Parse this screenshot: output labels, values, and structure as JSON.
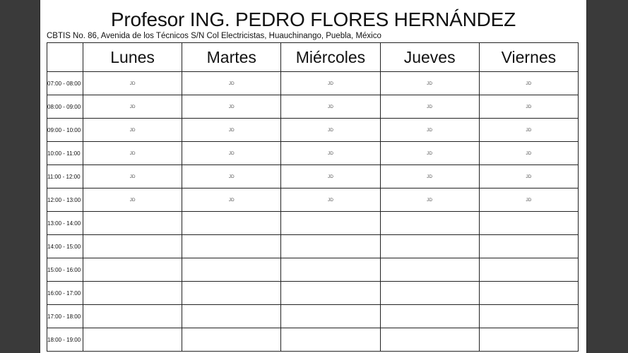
{
  "title": "Profesor ING. PEDRO FLORES HERNÁNDEZ",
  "address": "CBTIS No. 86, Avenida de los Técnicos S/N Col Electricistas, Huauchinango, Puebla, México",
  "days": [
    "Lunes",
    "Martes",
    "Miércoles",
    "Jueves",
    "Viernes"
  ],
  "rows": [
    {
      "time": "07:00 - 08:00",
      "cells": [
        "JD",
        "JD",
        "JD",
        "JD",
        "JD"
      ]
    },
    {
      "time": "08:00 - 09:00",
      "cells": [
        "JD",
        "JD",
        "JD",
        "JD",
        "JD"
      ]
    },
    {
      "time": "09:00 - 10:00",
      "cells": [
        "JD",
        "JD",
        "JD",
        "JD",
        "JD"
      ]
    },
    {
      "time": "10:00 - 11:00",
      "cells": [
        "JD",
        "JD",
        "JD",
        "JD",
        "JD"
      ]
    },
    {
      "time": "11:00 - 12:00",
      "cells": [
        "JD",
        "JD",
        "JD",
        "JD",
        "JD"
      ]
    },
    {
      "time": "12:00 - 13:00",
      "cells": [
        "JD",
        "JD",
        "JD",
        "JD",
        "JD"
      ]
    },
    {
      "time": "13:00 - 14:00",
      "cells": [
        "",
        "",
        "",
        "",
        ""
      ]
    },
    {
      "time": "14:00 - 15:00",
      "cells": [
        "",
        "",
        "",
        "",
        ""
      ]
    },
    {
      "time": "15:00 - 16:00",
      "cells": [
        "",
        "",
        "",
        "",
        ""
      ]
    },
    {
      "time": "16:00 - 17:00",
      "cells": [
        "",
        "",
        "",
        "",
        ""
      ]
    },
    {
      "time": "17:00 - 18:00",
      "cells": [
        "",
        "",
        "",
        "",
        ""
      ]
    },
    {
      "time": "18:00 - 19:00",
      "cells": [
        "",
        "",
        "",
        "",
        ""
      ]
    }
  ]
}
